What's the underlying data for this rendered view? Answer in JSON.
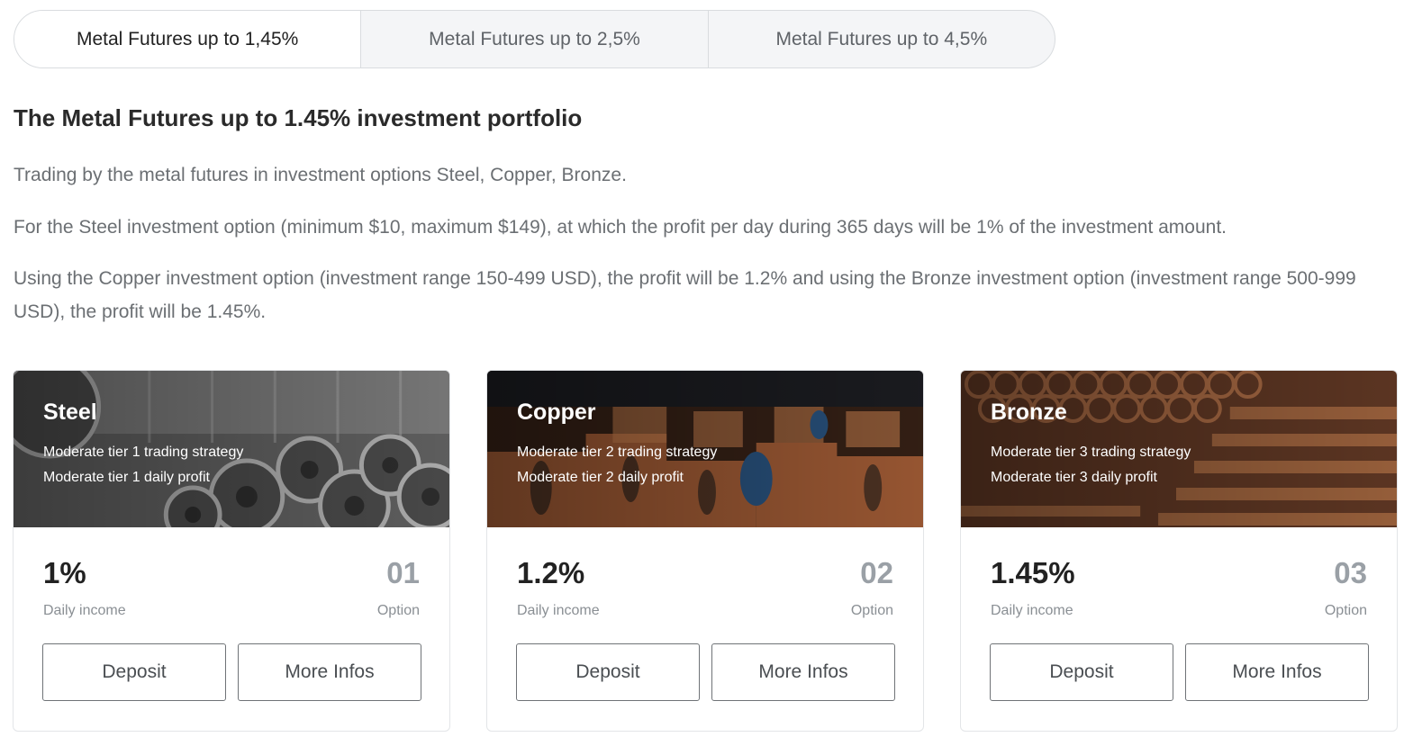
{
  "tabs": [
    {
      "label": "Metal Futures up to 1,45%",
      "active": true
    },
    {
      "label": "Metal Futures up to 2,5%",
      "active": false
    },
    {
      "label": "Metal Futures up to 4,5%",
      "active": false
    }
  ],
  "heading": "The Metal Futures up to 1.45% investment portfolio",
  "paragraphs": [
    "Trading by the metal futures in investment options Steel, Copper, Bronze.",
    "For the Steel investment option (minimum $10, maximum $149), at which the profit per day during 365 days will be 1% of the investment amount.",
    "Using the Copper investment option (investment range 150-499 USD), the profit will be 1.2% and using the Bronze investment option (investment range 500-999 USD), the profit will be 1.45%."
  ],
  "cards": [
    {
      "name": "Steel",
      "strategy": "Moderate tier 1 trading strategy",
      "profit": "Moderate tier 1 daily profit",
      "income_value": "1%",
      "income_label": "Daily income",
      "option_value": "01",
      "option_label": "Option",
      "deposit_label": "Deposit",
      "more_label": "More Infos",
      "image_icon": "steel-coils-image"
    },
    {
      "name": "Copper",
      "strategy": "Moderate tier 2 trading strategy",
      "profit": "Moderate tier 2 daily profit",
      "income_value": "1.2%",
      "income_label": "Daily income",
      "option_value": "02",
      "option_label": "Option",
      "deposit_label": "Deposit",
      "more_label": "More Infos",
      "image_icon": "copper-spools-image"
    },
    {
      "name": "Bronze",
      "strategy": "Moderate tier 3 trading strategy",
      "profit": "Moderate tier 3 daily profit",
      "income_value": "1.45%",
      "income_label": "Daily income",
      "option_value": "03",
      "option_label": "Option",
      "deposit_label": "Deposit",
      "more_label": "More Infos",
      "image_icon": "bronze-pipes-image"
    }
  ]
}
